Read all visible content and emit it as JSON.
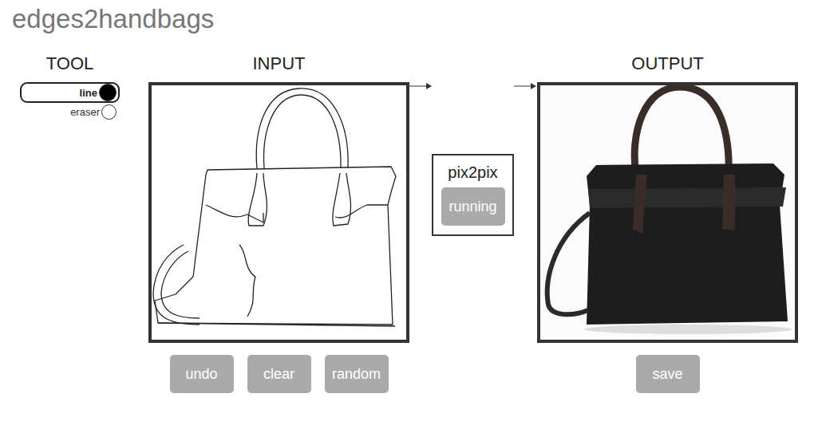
{
  "title": "edges2handbags",
  "tool": {
    "label": "TOOL",
    "options": [
      {
        "label": "line",
        "selected": true
      },
      {
        "label": "eraser",
        "selected": false
      }
    ]
  },
  "input": {
    "label": "INPUT",
    "buttons": [
      "undo",
      "clear",
      "random"
    ]
  },
  "model": {
    "label": "pix2pix",
    "button": "running"
  },
  "output": {
    "label": "OUTPUT",
    "buttons": [
      "save"
    ]
  }
}
